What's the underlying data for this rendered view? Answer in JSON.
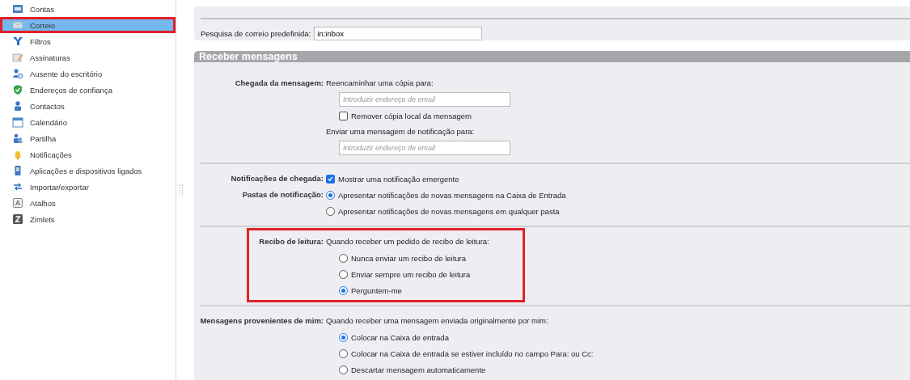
{
  "sidebar": {
    "items": [
      {
        "label": "Contas",
        "selected": false
      },
      {
        "label": "Correio",
        "selected": true,
        "highlighted": true
      },
      {
        "label": "Filtros",
        "selected": false
      },
      {
        "label": "Assinaturas",
        "selected": false
      },
      {
        "label": "Ausente do escritório",
        "selected": false
      },
      {
        "label": "Endereços de confiança",
        "selected": false
      },
      {
        "label": "Contactos",
        "selected": false
      },
      {
        "label": "Calendário",
        "selected": false
      },
      {
        "label": "Partilha",
        "selected": false
      },
      {
        "label": "Notificações",
        "selected": false
      },
      {
        "label": "Aplicações e dispositivos ligados",
        "selected": false
      },
      {
        "label": "Importar/exportar",
        "selected": false
      },
      {
        "label": "Atalhos",
        "selected": false
      },
      {
        "label": "Zimlets",
        "selected": false
      }
    ]
  },
  "top_panel": {
    "label": "Pesquisa de correio predefinida:",
    "value": "in:inbox"
  },
  "section": {
    "title": "Receber mensagens",
    "groups": [
      {
        "highlighted": false,
        "rows": [
          {
            "label": "Chegada da mensagem:",
            "items": [
              {
                "kind": "text",
                "text": "Reencaminhar uma cópia para:"
              },
              {
                "kind": "input",
                "placeholder": "Introduzir endereço de email"
              },
              {
                "kind": "checkbox",
                "label": "Remover cópia local da mensagem",
                "checked": false
              },
              {
                "kind": "text",
                "text": "Enviar uma mensagem de notificação para:"
              },
              {
                "kind": "input",
                "placeholder": "Introduzir endereço de email"
              }
            ]
          }
        ]
      },
      {
        "highlighted": false,
        "rows": [
          {
            "label": "Notificações de chegada:",
            "items": [
              {
                "kind": "checkbox",
                "label": "Mostrar uma notificação emergente",
                "checked": true
              }
            ]
          },
          {
            "label": "Pastas de notificação:",
            "items": [
              {
                "kind": "radio",
                "label": "Apresentar notificações de novas mensagens na Caixa de Entrada",
                "selected": true
              },
              {
                "kind": "radio",
                "label": "Apresentar notificações de novas mensagens em qualquer pasta",
                "selected": false
              }
            ]
          }
        ]
      },
      {
        "highlighted": true,
        "rows": [
          {
            "label": "Recibo de leitura:",
            "items": [
              {
                "kind": "text",
                "text": "Quando receber um pedido de recibo de leitura:"
              },
              {
                "kind": "radio",
                "label": "Nunca enviar um recibo de leitura",
                "selected": false
              },
              {
                "kind": "radio",
                "label": "Enviar sempre um recibo de leitura",
                "selected": false
              },
              {
                "kind": "radio",
                "label": "Perguntem-me",
                "selected": true
              }
            ]
          }
        ]
      },
      {
        "highlighted": false,
        "rows": [
          {
            "label": "Mensagens provenientes de mim:",
            "items": [
              {
                "kind": "text",
                "text": "Quando receber uma mensagem enviada originalmente por mim:"
              },
              {
                "kind": "radio",
                "label": "Colocar na Caixa de entrada",
                "selected": true
              },
              {
                "kind": "radio",
                "label": "Colocar na Caixa de entrada se estiver incluído no campo Para: ou Cc:",
                "selected": false
              },
              {
                "kind": "radio",
                "label": "Descartar mensagem automaticamente",
                "selected": false
              }
            ]
          }
        ]
      }
    ]
  }
}
